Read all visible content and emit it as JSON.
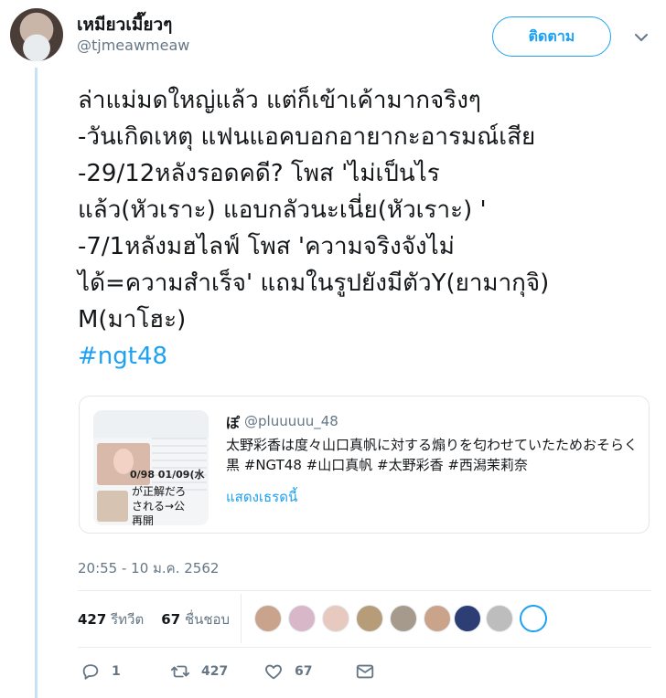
{
  "author": {
    "display_name": "เหมียวเมี๊ยวๆ",
    "handle": "@tjmeawmeaw"
  },
  "header": {
    "follow_label": "ติดตาม",
    "caret_icon": "chevron-down-icon"
  },
  "tweet": {
    "lines": [
      "ล่าแม่มดใหญ่แล้ว แต่ก็เข้าเค้ามากจริงๆ",
      "-วันเกิดเหตุ แฟนแอคบอกอายากะอารมณ์เสีย",
      "-29/12หลังรอดคดี? โพส 'ไม่เป็นไร",
      "แล้ว(หัวเราะ) แอบกลัวนะเนี่ย(หัวเราะ) '",
      "-7/1หลังมฮไลฟ์ โพส 'ความจริงจังไม่",
      "ได้=ความสำเร็จ' แถมในรูปยังมีตัวY(ยามากุจิ)",
      "M(มาโฮะ)"
    ],
    "hashtag": "#ngt48",
    "timestamp": "20:55 - 10 ม.ค. 2562"
  },
  "quote": {
    "name": "ぽ",
    "handle": "@pluuuuu_48",
    "body": "太野彩香は度々山口真帆に対する煽りを匂わせていたためおそらく黒 #NGT48 #山口真帆 #太野彩香 #西潟茉莉奈",
    "show_thread": "แสดงเธรดนี้",
    "thumb_text": {
      "date": "0/98 01/09(水",
      "line1": "が正解だろ",
      "line2": "される→公",
      "line3": "再開"
    }
  },
  "stats": {
    "retweets_count": "427",
    "retweets_label": "รีทวีต",
    "likes_count": "67",
    "likes_label": "ชื่นชอบ"
  },
  "likers": {
    "colors": [
      "#c9a38c",
      "#d8b8c8",
      "#e7c9c0",
      "#b79c7a",
      "#a69a8c",
      "#caa48a",
      "#2c3e73",
      "#bdbdbd",
      "#ffffff"
    ]
  },
  "actions": {
    "reply_count": "1",
    "retweet_count": "427",
    "like_count": "67"
  },
  "colors": {
    "accent": "#1da1f2",
    "text_primary": "#14171a",
    "text_secondary": "#657786",
    "thread_line": "#c4e3f7"
  }
}
